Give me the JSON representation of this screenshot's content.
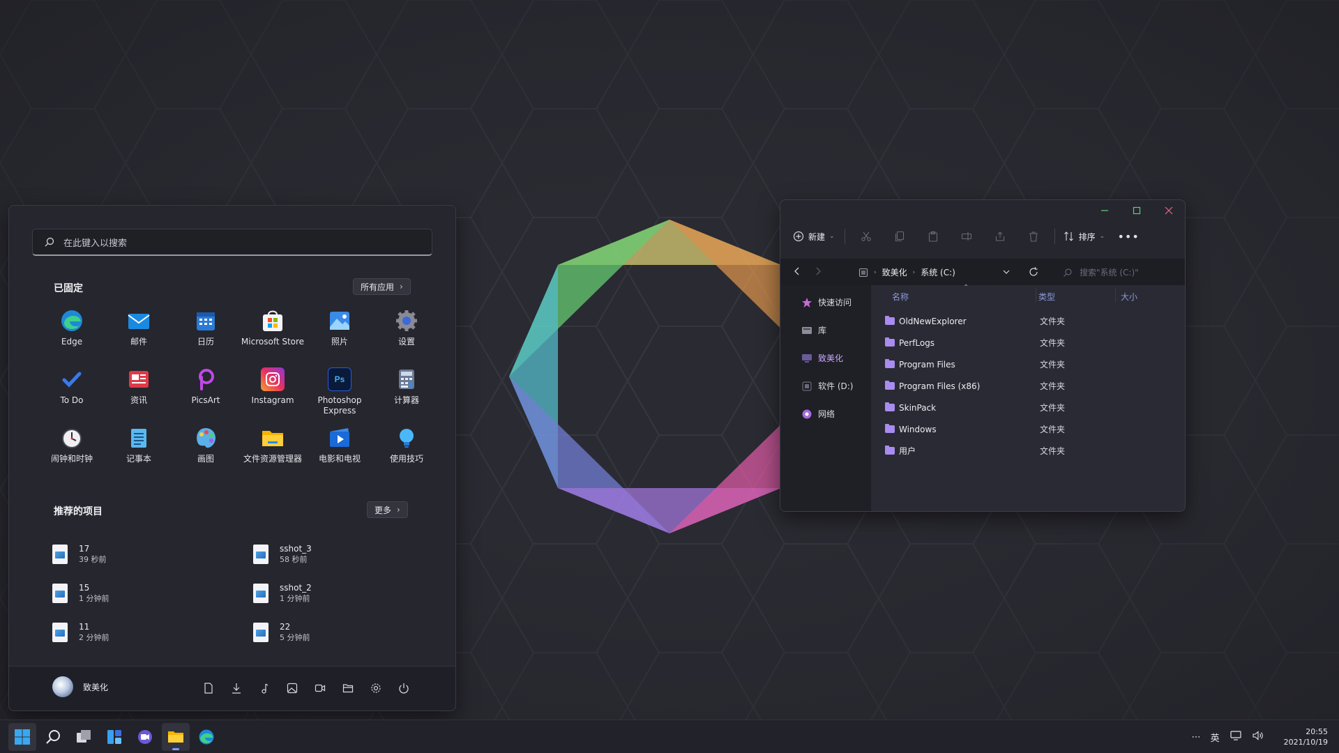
{
  "start_menu": {
    "search_placeholder": "在此键入以搜索",
    "pinned_title": "已固定",
    "all_apps_label": "所有应用",
    "pinned": [
      {
        "label": "Edge",
        "icon": "edge-icon"
      },
      {
        "label": "邮件",
        "icon": "mail-icon"
      },
      {
        "label": "日历",
        "icon": "calendar-icon"
      },
      {
        "label": "Microsoft Store",
        "icon": "store-icon"
      },
      {
        "label": "照片",
        "icon": "photos-icon"
      },
      {
        "label": "设置",
        "icon": "settings-icon"
      },
      {
        "label": "To Do",
        "icon": "todo-icon"
      },
      {
        "label": "资讯",
        "icon": "news-icon"
      },
      {
        "label": "PicsArt",
        "icon": "picsart-icon"
      },
      {
        "label": "Instagram",
        "icon": "instagram-icon"
      },
      {
        "label": "Photoshop Express",
        "icon": "photoshop-icon"
      },
      {
        "label": "计算器",
        "icon": "calculator-icon"
      },
      {
        "label": "闹钟和时钟",
        "icon": "clock-icon"
      },
      {
        "label": "记事本",
        "icon": "notepad-icon"
      },
      {
        "label": "画图",
        "icon": "paint-icon"
      },
      {
        "label": "文件资源管理器",
        "icon": "file-explorer-icon"
      },
      {
        "label": "电影和电视",
        "icon": "movies-icon"
      },
      {
        "label": "使用技巧",
        "icon": "tips-icon"
      }
    ],
    "recommended_title": "推荐的项目",
    "more_label": "更多",
    "recommended": [
      {
        "name": "17",
        "time": "39 秒前"
      },
      {
        "name": "sshot_3",
        "time": "58 秒前"
      },
      {
        "name": "15",
        "time": "1 分钟前"
      },
      {
        "name": "sshot_2",
        "time": "1 分钟前"
      },
      {
        "name": "11",
        "time": "2 分钟前"
      },
      {
        "name": "22",
        "time": "5 分钟前"
      }
    ],
    "user_name": "致美化",
    "footer_icons": [
      "document-icon",
      "download-icon",
      "music-icon",
      "pictures-icon",
      "videos-icon",
      "folder-icon",
      "settings-icon",
      "power-icon"
    ]
  },
  "explorer": {
    "new_label": "新建",
    "sort_label": "排序",
    "breadcrumb": [
      "致美化",
      "系统 (C:)"
    ],
    "search_placeholder": "搜索\"系统 (C:)\"",
    "nav_items": [
      {
        "label": "快速访问",
        "icon": "star-icon",
        "color": "#c86ad8"
      },
      {
        "label": "库",
        "icon": "library-icon",
        "color": "#8c8c9a"
      },
      {
        "label": "致美化",
        "icon": "pc-icon",
        "color": "#6a5a9a",
        "active": true
      },
      {
        "label": "软件 (D:)",
        "icon": "drive-icon",
        "color": "#6a6a7a"
      },
      {
        "label": "网络",
        "icon": "network-icon",
        "color": "#a86ad8"
      }
    ],
    "columns": {
      "name": "名称",
      "type": "类型",
      "size": "大小"
    },
    "files": [
      {
        "name": "OldNewExplorer",
        "type": "文件夹"
      },
      {
        "name": "PerfLogs",
        "type": "文件夹"
      },
      {
        "name": "Program Files",
        "type": "文件夹"
      },
      {
        "name": "Program Files (x86)",
        "type": "文件夹"
      },
      {
        "name": "SkinPack",
        "type": "文件夹"
      },
      {
        "name": "Windows",
        "type": "文件夹"
      },
      {
        "name": "用户",
        "type": "文件夹"
      }
    ]
  },
  "taskbar": {
    "icons": [
      "start-icon",
      "search-icon",
      "task-view-icon",
      "widgets-icon",
      "chat-icon",
      "file-explorer-icon",
      "edge-icon"
    ],
    "tray_overflow": "⋯",
    "ime_label": "英",
    "time": "20:55",
    "date": "2021/10/19"
  },
  "colors": {
    "accent": "#a88cf0",
    "window_bg": "#26262e",
    "desktop_bg": "#2b2b33"
  }
}
